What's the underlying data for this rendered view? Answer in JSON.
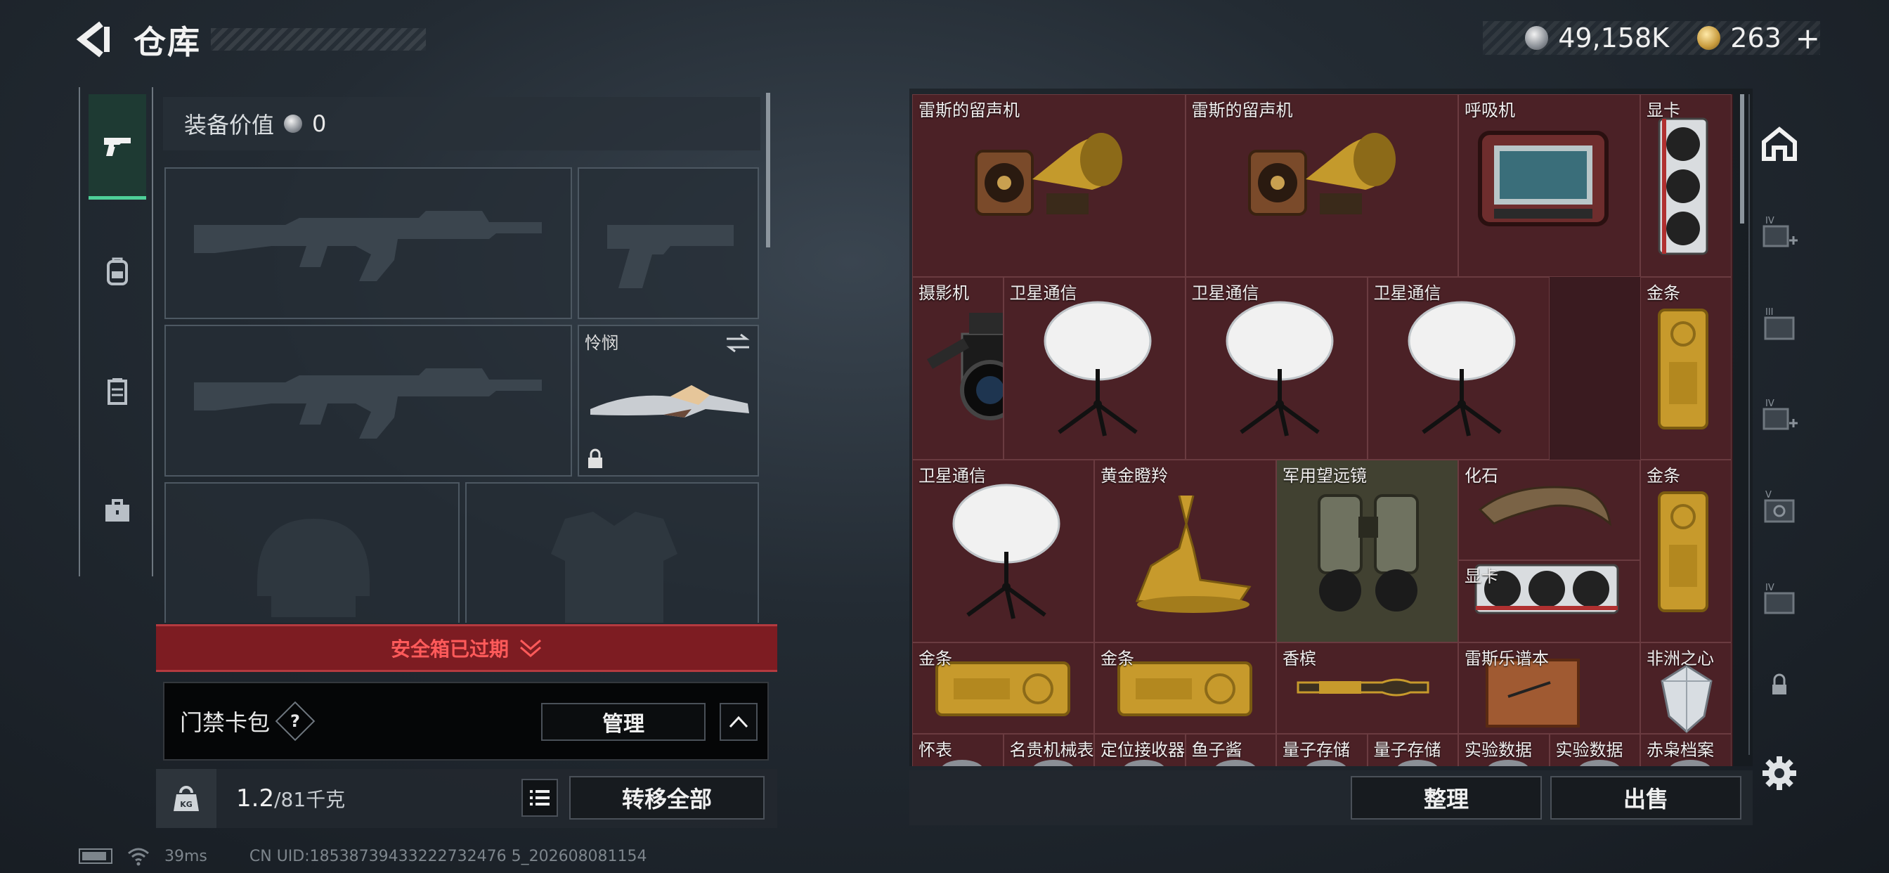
{
  "header": {
    "title": "仓库",
    "currency": [
      {
        "icon": "silver-coin-icon",
        "value": "49,158K"
      },
      {
        "icon": "gold-coin-icon",
        "value": "263"
      }
    ],
    "add_label": "+"
  },
  "equipment": {
    "value_label": "装备价值",
    "value": "0",
    "melee_name": "怜悯",
    "warning": "安全箱已过期",
    "keycard_label": "门禁卡包",
    "help": "?",
    "manage": "管理",
    "weight_value": "1.2",
    "weight_max": "/81千克",
    "transfer_all": "转移全部"
  },
  "warehouse": {
    "items": [
      {
        "name": "雷斯的留声机",
        "art": "gramophone"
      },
      {
        "name": "雷斯的留声机",
        "art": "gramophone"
      },
      {
        "name": "呼吸机",
        "art": "ventilator"
      },
      {
        "name": "显卡",
        "art": "gpu-vertical"
      },
      {
        "name": "摄影机",
        "art": "camera"
      },
      {
        "name": "卫星通信",
        "art": "satellite"
      },
      {
        "name": "卫星通信",
        "art": "satellite"
      },
      {
        "name": "卫星通信",
        "art": "satellite"
      },
      {
        "name": "金条",
        "art": "gold-bar-vertical"
      },
      {
        "name": "卫星通信",
        "art": "satellite"
      },
      {
        "name": "黄金瞪羚",
        "art": "gazelle"
      },
      {
        "name": "军用望远镜",
        "art": "binoculars"
      },
      {
        "name": "化石",
        "art": "fossil"
      },
      {
        "name": "金条",
        "art": "gold-bar-vertical"
      },
      {
        "name": "显卡",
        "art": "gpu-horizontal"
      },
      {
        "name": "金条",
        "art": "gold-bar"
      },
      {
        "name": "金条",
        "art": "gold-bar"
      },
      {
        "name": "香槟",
        "art": "champagne"
      },
      {
        "name": "雷斯乐谱本",
        "art": "notebook"
      },
      {
        "name": "非洲之心",
        "art": "diamond"
      },
      {
        "name": "怀表",
        "art": "partial"
      },
      {
        "name": "名贵机械表",
        "art": "partial"
      },
      {
        "name": "定位接收器",
        "art": "partial"
      },
      {
        "name": "鱼子酱",
        "art": "partial"
      },
      {
        "name": "量子存储",
        "art": "partial"
      },
      {
        "name": "量子存储",
        "art": "partial"
      },
      {
        "name": "实验数据",
        "art": "partial"
      },
      {
        "name": "实验数据",
        "art": "partial"
      },
      {
        "name": "赤枭档案",
        "art": "partial"
      }
    ],
    "sort": "整理",
    "sell": "出售"
  },
  "status": {
    "ping": "39ms",
    "uid": "CN UID:18538739433222732476 5_202608081154"
  }
}
